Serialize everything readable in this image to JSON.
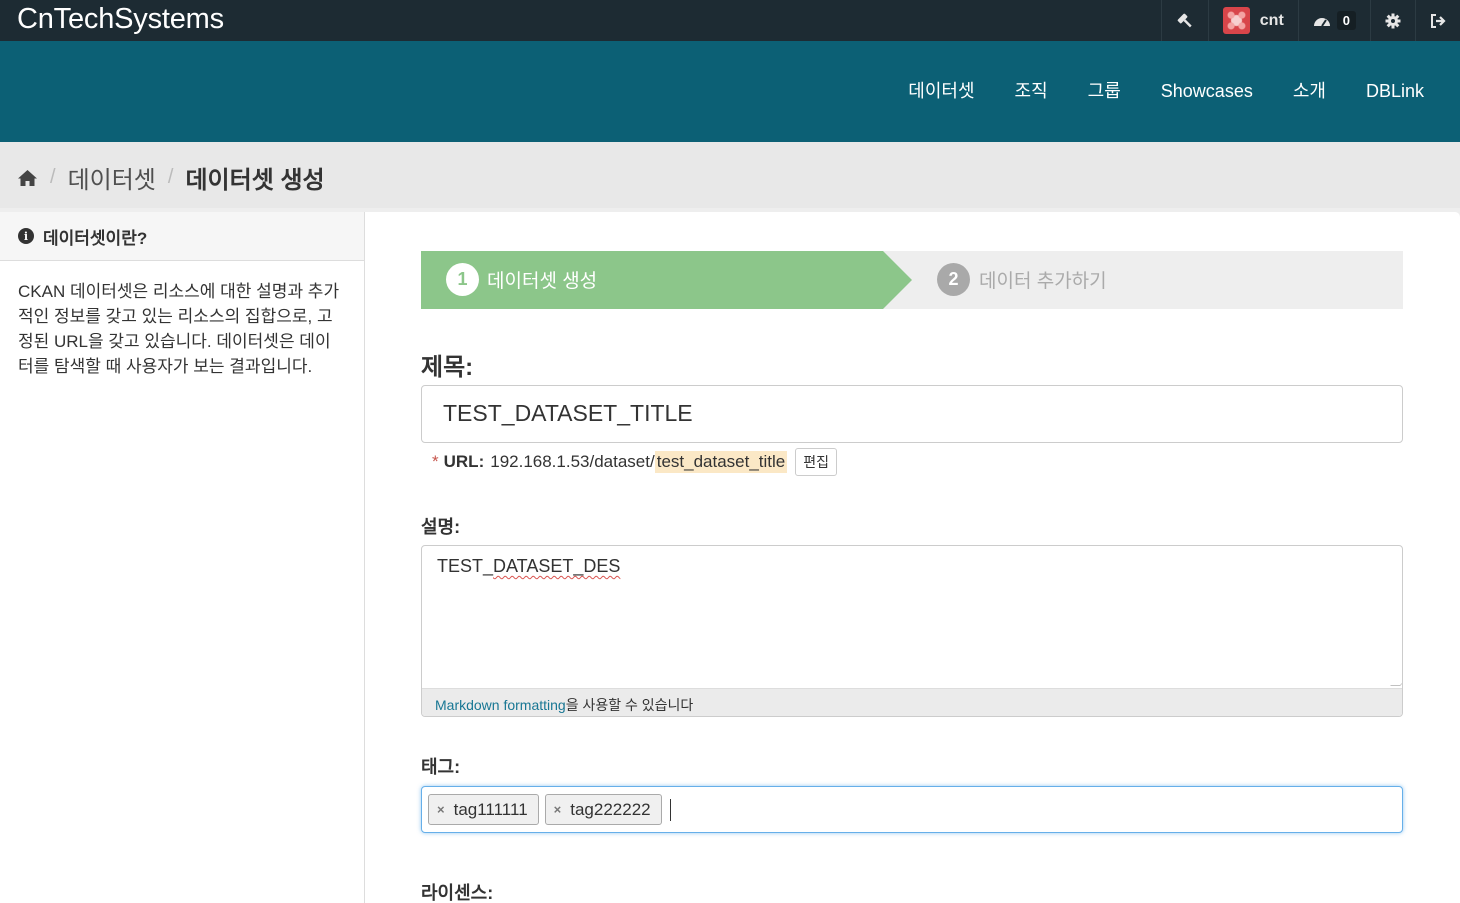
{
  "brand": "CnTechSystems",
  "account": {
    "username": "cnt",
    "dashboard_count": "0"
  },
  "nav": [
    "데이터셋",
    "조직",
    "그룹",
    "Showcases",
    "소개",
    "DBLink"
  ],
  "breadcrumb": {
    "items": [
      "데이터셋",
      "데이터셋 생성"
    ]
  },
  "sidebar": {
    "title": "데이터셋이란?",
    "body": "CKAN 데이터셋은 리소스에 대한 설명과 추가적인 정보를 갖고 있는 리소스의 집합으로, 고정된 URL을 갖고 있습니다. 데이터셋은 데이터를 탐색할 때 사용자가 보는 결과입니다."
  },
  "stages": [
    {
      "num": "1",
      "label": "데이터셋 생성"
    },
    {
      "num": "2",
      "label": "데이터 추가하기"
    }
  ],
  "form": {
    "title_label": "제목:",
    "title_value": "TEST_DATASET_TITLE",
    "url_label": "URL:",
    "url_prefix": "192.168.1.53/dataset/",
    "url_slug": "test_dataset_title",
    "edit_button": "편집",
    "desc_label": "설명:",
    "desc_value_a": "TEST_",
    "desc_value_b": "DATASET_DES",
    "markdown_link": "Markdown formatting",
    "markdown_suffix": "을 사용할 수 있습니다",
    "tags_label": "태그:",
    "tags": [
      "tag111111",
      "tag222222"
    ],
    "license_label": "라이센스:"
  },
  "colors": {
    "topbar": "#1d2b33",
    "masthead": "#0c6075",
    "stage_active": "#8cc68a",
    "link": "#187794"
  }
}
